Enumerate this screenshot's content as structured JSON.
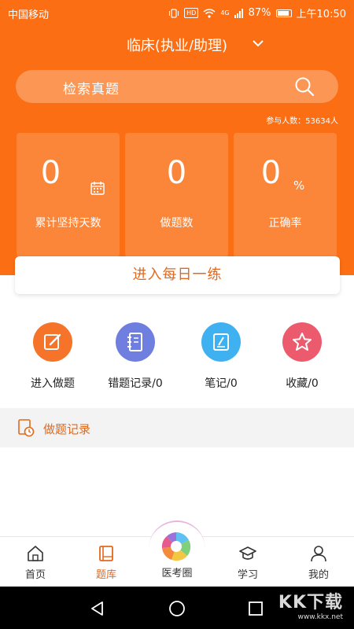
{
  "status_bar": {
    "carrier": "中国移动",
    "badge": "HD",
    "network": "4G",
    "battery": "87%",
    "time": "上午10:50"
  },
  "header": {
    "title": "临床(执业/助理)",
    "search_placeholder": "检索真题",
    "participants": "参与人数：53634人"
  },
  "stats": [
    {
      "value": "0",
      "label": "累计坚持天数",
      "icon": "calendar-icon"
    },
    {
      "value": "0",
      "label": "做题数"
    },
    {
      "value": "0",
      "suffix": "%",
      "label": "正确率"
    }
  ],
  "daily_button": "进入每日一练",
  "functions": [
    {
      "label": "进入做题",
      "icon": "edit-icon",
      "color": "#f5742a"
    },
    {
      "label": "错题记录/0",
      "icon": "notebook-icon",
      "color": "#6f7fe0"
    },
    {
      "label": "笔记/0",
      "icon": "note-icon",
      "color": "#3fb1f0"
    },
    {
      "label": "收藏/0",
      "icon": "star-icon",
      "color": "#ec5b6d"
    }
  ],
  "record_section": {
    "label": "做题记录",
    "icon": "history-icon"
  },
  "tabs": [
    {
      "label": "首页",
      "icon": "home-icon"
    },
    {
      "label": "题库",
      "icon": "book-icon",
      "active": true
    },
    {
      "label": "医考圈",
      "icon": "aperture-icon"
    },
    {
      "label": "学习",
      "icon": "grad-cap-icon"
    },
    {
      "label": "我的",
      "icon": "user-icon"
    }
  ],
  "watermark": {
    "main": "KK下载",
    "sub": "www.kkx.net"
  },
  "colors": {
    "brand": "#fb6e14",
    "accent_text": "#e2681c"
  }
}
